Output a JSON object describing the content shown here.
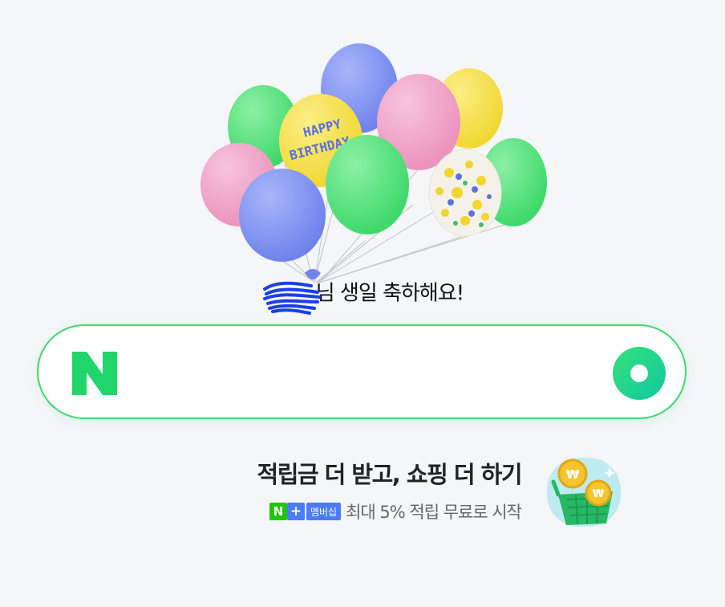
{
  "greeting": {
    "text": "님 생일 축하해요!"
  },
  "search": {
    "logo_letter": "N",
    "value": "",
    "placeholder": ""
  },
  "promo": {
    "title": "적립금 더 받고, 쇼핑 더 하기",
    "badge_letter": "N",
    "badge_plus": "+",
    "badge_label": "멤버십",
    "subtitle": "최대 5% 적립 무료로 시작"
  },
  "colors": {
    "accent_green": "#41d86e",
    "logo_green": "#20d66a",
    "membership_blue": "#4a7cf5",
    "balloon_green": "#4fdf78",
    "balloon_blue": "#7b8ef0",
    "balloon_pink": "#f0a3c8",
    "balloon_yellow": "#f6e04a"
  },
  "icons": [
    "birthday-balloons",
    "naver-n-logo",
    "search-icon",
    "coin-basket-icon"
  ]
}
